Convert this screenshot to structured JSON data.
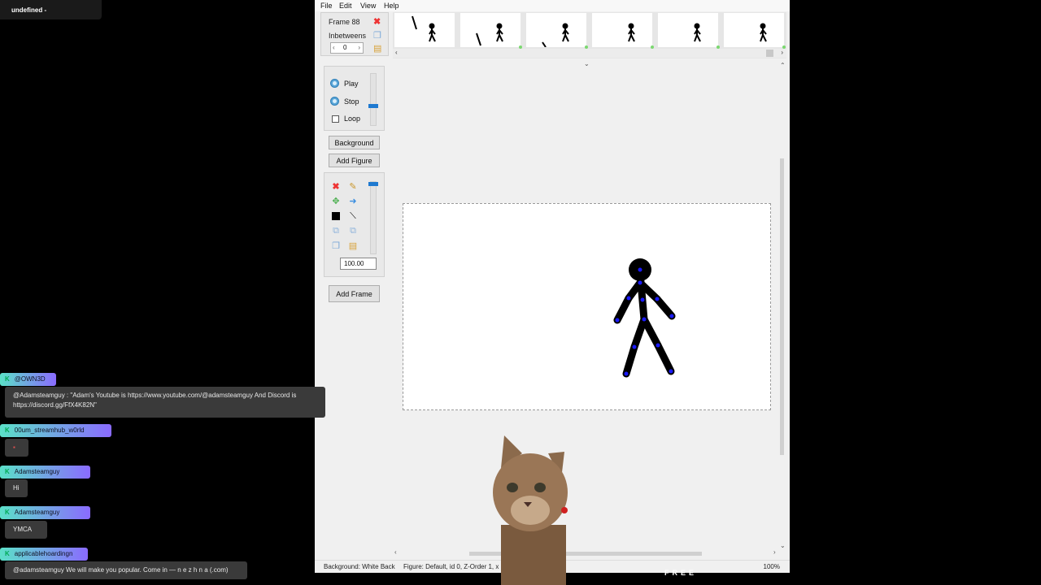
{
  "stream": {
    "title": "undefined -"
  },
  "menu": {
    "file": "File",
    "edit": "Edit",
    "view": "View",
    "help": "Help"
  },
  "frame": {
    "label": "Frame 88",
    "inbetweens_label": "Inbetweens",
    "inbetweens_value": "0"
  },
  "playback": {
    "play": "Play",
    "stop": "Stop",
    "loop": "Loop",
    "speed_level": 0.4
  },
  "buttons": {
    "background": "Background",
    "add_figure": "Add Figure",
    "add_frame": "Add Frame"
  },
  "tools": {
    "scale_value": "100.00"
  },
  "status": {
    "background": "Background: White Back",
    "figure": "Figure: Default,  id 0,  Z-Order 1,  x",
    "zoom": "100%"
  },
  "chat": [
    {
      "user": "@OWN3D",
      "message": "@Adamsteamguy : \"Adam's Youtube is https://www.youtube.com/@adamsteamguy And Discord is https://discord.gg/FfX4K82N\""
    },
    {
      "user": "00um_streamhub_w0rld",
      "message": "▪"
    },
    {
      "user": "Adamsteamguy",
      "message": "Hi"
    },
    {
      "user": "Adamsteamguy",
      "message": "YMCA"
    },
    {
      "user": "applicablehoardingn",
      "message": "@adamsteamguy We will make you popular. Come in — n e z h n a (.com)"
    }
  ],
  "overlay": {
    "text": "FREE"
  },
  "colors": {
    "accent": "#1e79d0",
    "joint": "#1a1aff",
    "frame_marker": "#7bd870"
  }
}
